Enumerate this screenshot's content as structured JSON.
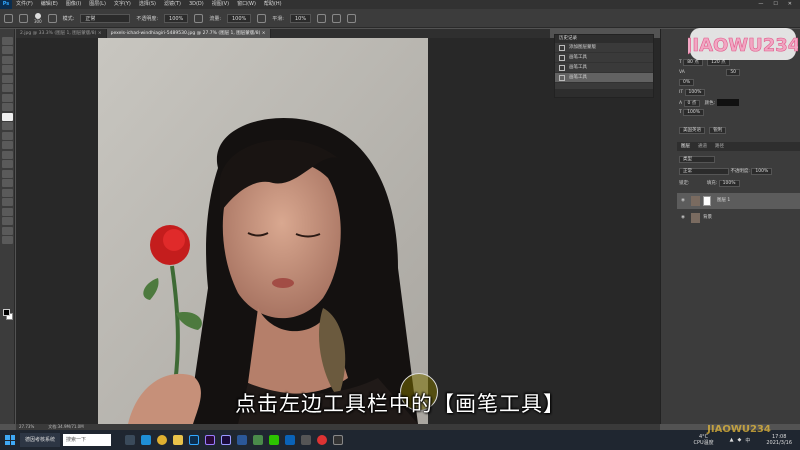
{
  "menubar": {
    "items": [
      "文件(F)",
      "编辑(E)",
      "图像(I)",
      "图层(L)",
      "文字(Y)",
      "选择(S)",
      "滤镜(T)",
      "3D(D)",
      "视图(V)",
      "窗口(W)",
      "帮助(H)"
    ]
  },
  "options": {
    "brush_size": "300",
    "mode_label": "模式:",
    "mode_value": "正常",
    "opacity_label": "不透明度:",
    "opacity_value": "100%",
    "flow_label": "流量:",
    "flow_value": "100%",
    "smooth_label": "平滑:",
    "smooth_value": "10%"
  },
  "doc_tabs": [
    {
      "label": "2.jpg @ 33.3% (图层 1, 图层蒙版/8) ×"
    },
    {
      "label": "pexels-ichad-windhiagiri-5489530.jpg @ 27.7% (图层 1, 图层蒙版/8) ×"
    }
  ],
  "history": {
    "title": "历史记录",
    "items": [
      "添加图层蒙版",
      "画笔工具",
      "画笔工具",
      "画笔工具"
    ]
  },
  "character": {
    "size": "80 点",
    "leading": "120 点",
    "tracking": "50",
    "kern": "0%",
    "scale_v": "100%",
    "scale_h": "100%",
    "baseline": "0 点",
    "color_label": "颜色:",
    "lang": "美国英语",
    "aa": "锐利"
  },
  "layers": {
    "tabs": [
      "图层",
      "通道",
      "路径"
    ],
    "filter_label": "类型",
    "blend": "正常",
    "opacity_label": "不透明度:",
    "opacity": "100%",
    "lock_label": "锁定:",
    "fill_label": "填充:",
    "fill": "100%",
    "rows": [
      {
        "name": "图层 1"
      },
      {
        "name": "背景"
      }
    ]
  },
  "status": {
    "zoom": "27.73%",
    "doc": "文档:34.9M/71.0M"
  },
  "taskbar": {
    "app_label": "德因考核系统",
    "search_placeholder": "搜索一下",
    "weather_temp": "4°C",
    "weather_desc": "CPU温度",
    "time": "17:08",
    "date": "2021/3/16"
  },
  "subtitle": "点击左边工具栏中的【画笔工具】",
  "watermark": "JIAOWU234",
  "colors": {
    "ps_dark": "#323232",
    "panel": "#3c3c3c",
    "canvas_bg": "#282828",
    "brush_fg": "#000000"
  }
}
